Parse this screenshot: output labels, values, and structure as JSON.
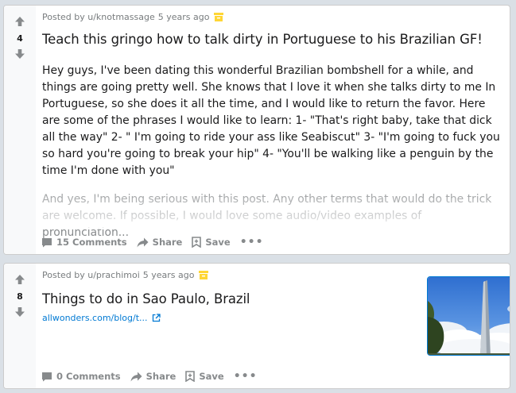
{
  "posts": [
    {
      "score": "4",
      "posted_by": "Posted by u/knotmassage",
      "time_ago": "5 years ago",
      "title": "Teach this gringo how to talk dirty in Portuguese to his Brazilian GF!",
      "body_paragraphs": [
        "Hey guys, I've been dating this wonderful Brazilian bombshell for a while, and things are going pretty well. She knows that I love it when she talks dirty to me In Portuguese, so she does it all the time, and I would like to return the favor. Here are some of the phrases I would like to learn: 1- \"That's right baby, take that dick all the way\" 2- \" I'm going to ride your ass like Seabiscut\" 3- \"I'm going to fuck you so hard you're going to break your hip\" 4- \"You'll be walking like a penguin by the time I'm done with you\"",
        "And yes, I'm being serious with this post. Any other terms that would do the trick are welcome. If possible, I would love some audio/video examples of pronunciation..."
      ],
      "comments_label": "15 Comments",
      "share_label": "Share",
      "save_label": "Save",
      "more_label": "•••"
    },
    {
      "score": "8",
      "posted_by": "Posted by u/prachimoi",
      "time_ago": "5 years ago",
      "title": "Things to do in Sao Paulo, Brazil",
      "link_text": "allwonders.com/blog/t...",
      "comments_label": "0 Comments",
      "share_label": "Share",
      "save_label": "Save",
      "more_label": "•••"
    }
  ],
  "colors": {
    "background": "#dae0e6",
    "award": "#ffd635",
    "link": "#0079d3",
    "meta": "#787c7e"
  }
}
